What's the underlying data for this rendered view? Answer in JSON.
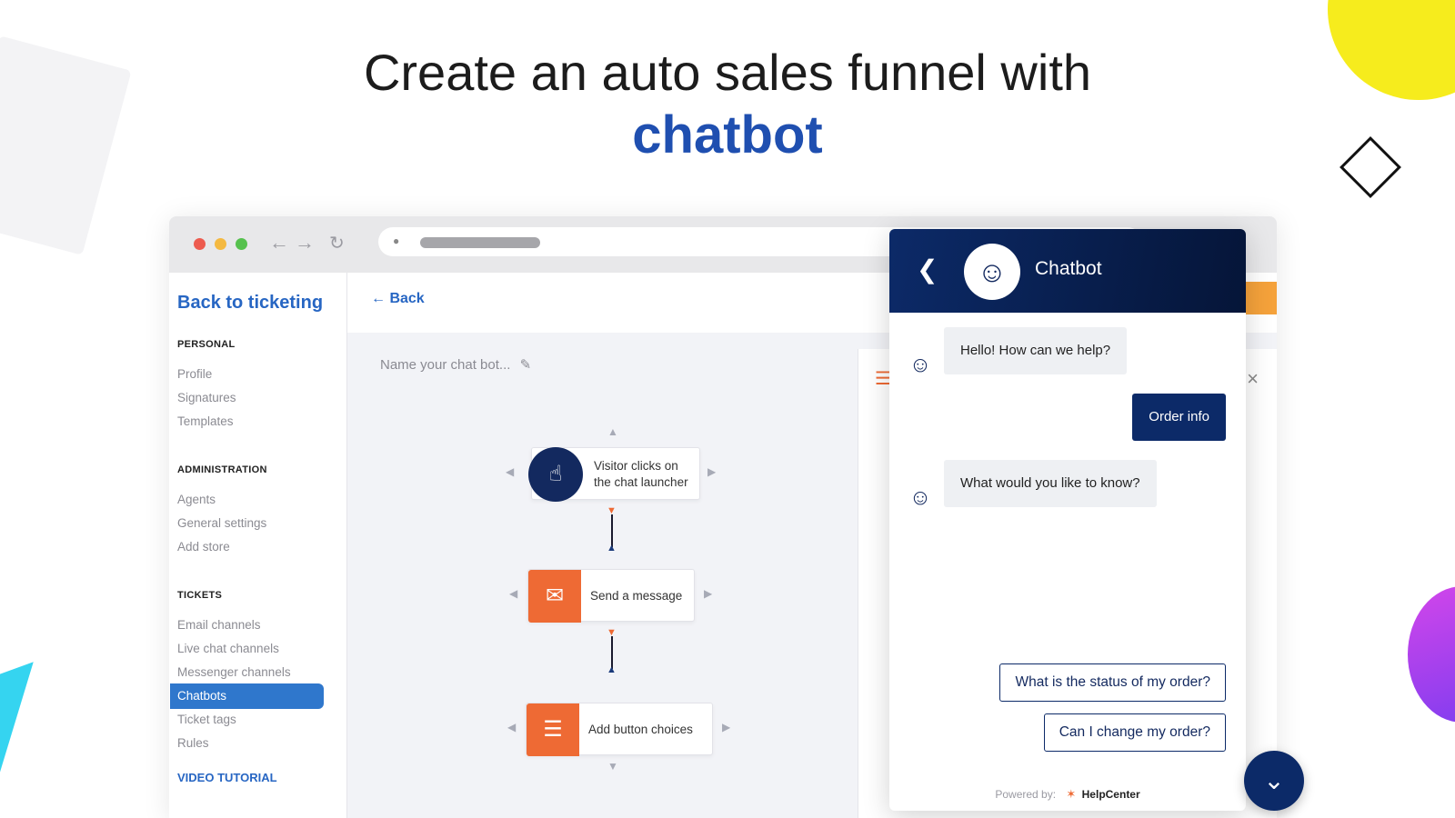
{
  "headline": {
    "line1": "Create an auto sales funnel with",
    "line2": "chatbot"
  },
  "browser": {
    "nav_back_icon": "arrow-left-icon",
    "nav_forward_icon": "arrow-right-icon",
    "reload_icon": "reload-icon",
    "lock_icon": "lock-icon"
  },
  "sidebar": {
    "back_label": "Back to ticketing",
    "sections": [
      {
        "title": "PERSONAL",
        "items": [
          "Profile",
          "Signatures",
          "Templates"
        ]
      },
      {
        "title": "ADMINISTRATION",
        "items": [
          "Agents",
          "General settings",
          "Add store"
        ]
      },
      {
        "title": "TICKETS",
        "items": [
          "Email channels",
          "Live chat channels",
          "Messenger channels",
          "Chatbots",
          "Ticket tags",
          "Rules"
        ]
      }
    ],
    "active_item": "Chatbots",
    "video_tutorial": "VIDEO TUTORIAL"
  },
  "editor": {
    "back_label": "Back",
    "bot_name_placeholder": "Name your chat bot...",
    "nodes": [
      {
        "line1": "Visitor clicks on",
        "line2": "the chat launcher",
        "icon": "pointer-hand-icon"
      },
      {
        "label": "Send a message",
        "icon": "message-icon"
      },
      {
        "label": "Add button choices",
        "icon": "buttons-icon"
      }
    ]
  },
  "chat": {
    "title": "Chatbot",
    "messages": [
      {
        "from": "bot",
        "text": "Hello! How can we help?"
      },
      {
        "from": "user",
        "text": "Order info"
      },
      {
        "from": "bot",
        "text": "What would you like to know?"
      }
    ],
    "choices": [
      "What is the status of my order?",
      "Can I change my order?"
    ],
    "powered_by": "Powered by:",
    "brand": "HelpCenter"
  },
  "colors": {
    "accent": "#2766c3",
    "navy": "#0c2a68",
    "orange": "#ee6a34",
    "headline_blue": "#1f4fb0"
  }
}
